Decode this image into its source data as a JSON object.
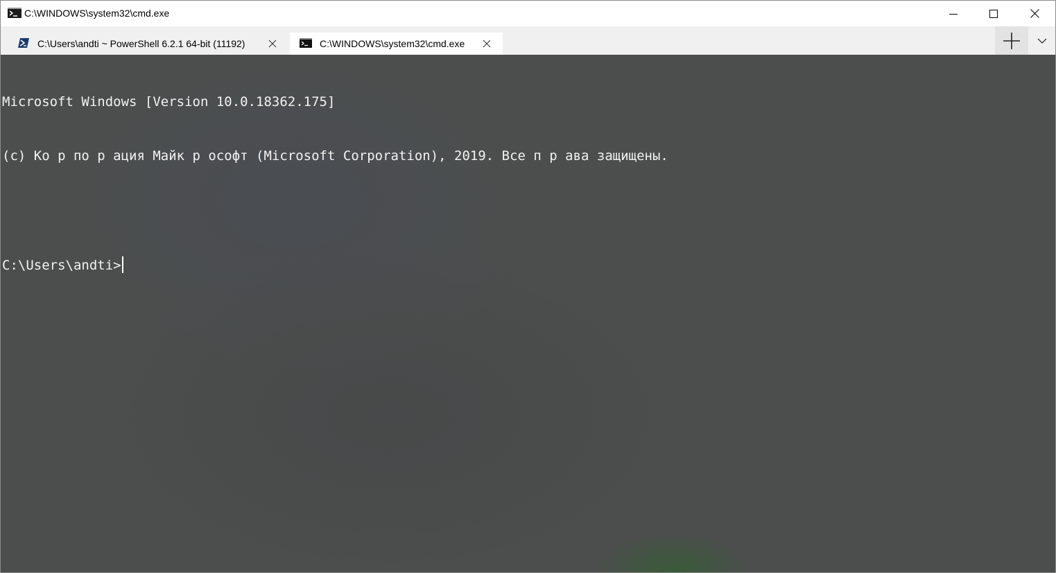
{
  "window": {
    "title": "C:\\WINDOWS\\system32\\cmd.exe",
    "icon": "cmd-icon"
  },
  "window_controls": {
    "minimize_icon": "minimize-icon",
    "maximize_icon": "maximize-icon",
    "close_icon": "close-icon"
  },
  "tabs": [
    {
      "label": "C:\\Users\\andti ~ PowerShell 6.2.1 64-bit (11192)",
      "icon": "powershell-icon",
      "active": false
    },
    {
      "label": "C:\\WINDOWS\\system32\\cmd.exe",
      "icon": "cmd-icon",
      "active": true
    }
  ],
  "tabstrip": {
    "new_tab_icon": "plus-icon",
    "dropdown_icon": "chevron-down-icon"
  },
  "terminal": {
    "lines": [
      "Microsoft Windows [Version 10.0.18362.175]",
      "(c) Ко р по р ация Майк р ософт (Microsoft Corporation), 2019. Все п р ава защищены.",
      "",
      "C:\\Users\\andti>"
    ]
  },
  "colors": {
    "terminal_background": "#4c4e4d",
    "terminal_foreground": "#f2f2f2",
    "tabstrip_background": "#f0f0f0",
    "active_tab_background": "#ffffff",
    "powershell_blue": "#1b3a6b"
  }
}
